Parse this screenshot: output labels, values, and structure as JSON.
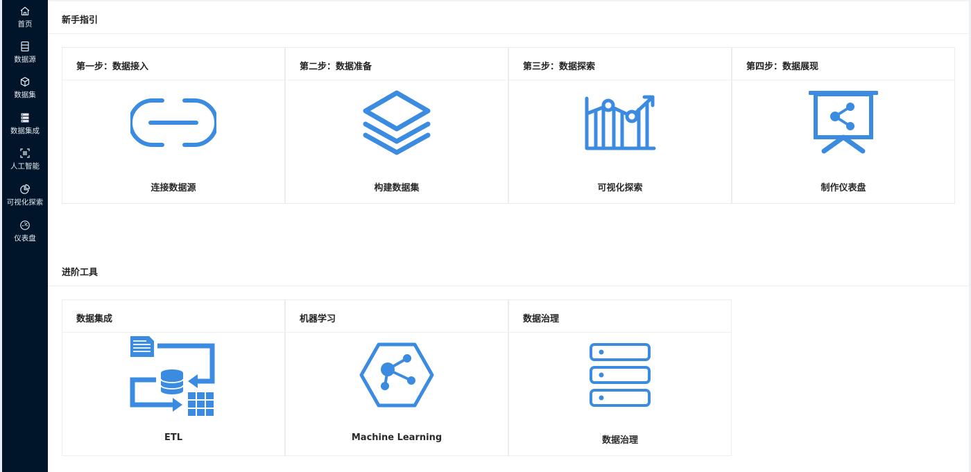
{
  "theme": {
    "sidebar_bg": "#001529",
    "accent": "#3b8be0"
  },
  "sidebar": {
    "items": [
      {
        "label": "首页",
        "icon": "home-icon"
      },
      {
        "label": "数据源",
        "icon": "database-icon"
      },
      {
        "label": "数据集",
        "icon": "cube-icon"
      },
      {
        "label": "数据集成",
        "icon": "server-icon"
      },
      {
        "label": "人工智能",
        "icon": "scan-icon"
      },
      {
        "label": "可视化探索",
        "icon": "pie-chart-icon"
      },
      {
        "label": "仪表盘",
        "icon": "gauge-icon"
      }
    ]
  },
  "beginner": {
    "title": "新手指引",
    "cards": [
      {
        "step": "第一步：数据接入",
        "label": "连接数据源",
        "icon": "link-icon"
      },
      {
        "step": "第二步：数据准备",
        "label": "构建数据集",
        "icon": "layers-icon"
      },
      {
        "step": "第三步：数据探索",
        "label": "可视化探索",
        "icon": "trend-chart-icon"
      },
      {
        "step": "第四步：数据展现",
        "label": "制作仪表盘",
        "icon": "presentation-share-icon"
      }
    ]
  },
  "advanced": {
    "title": "进阶工具",
    "cards": [
      {
        "title": "数据集成",
        "label": "ETL",
        "icon": "etl-icon"
      },
      {
        "title": "机器学习",
        "label": "Machine Learning",
        "icon": "hexagon-network-icon"
      },
      {
        "title": "数据治理",
        "label": "数据治理",
        "icon": "server-stack-icon"
      }
    ]
  }
}
